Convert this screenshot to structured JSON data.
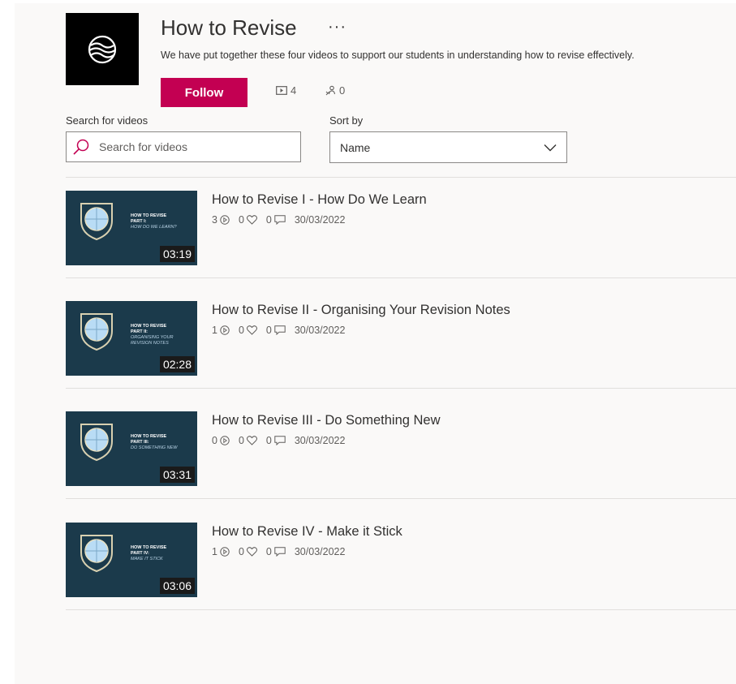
{
  "channel": {
    "title": "How to Revise",
    "more_label": "···",
    "description": "We have put together these four videos to support our students in understanding how to revise effectively.",
    "follow_label": "Follow",
    "video_count": "4",
    "follower_count": "0",
    "accent": "#c30052"
  },
  "search": {
    "label": "Search for videos",
    "placeholder": "Search for videos"
  },
  "sort": {
    "label": "Sort by",
    "selected": "Name"
  },
  "videos": [
    {
      "title": "How to Revise I - How Do We Learn",
      "views": "3",
      "likes": "0",
      "comments": "0",
      "date": "30/03/2022",
      "duration": "03:19",
      "thumb_title": "HOW TO REVISE",
      "thumb_part": "PART I:",
      "thumb_sub": "HOW DO WE LEARN?"
    },
    {
      "title": "How to Revise II - Organising Your Revision Notes",
      "views": "1",
      "likes": "0",
      "comments": "0",
      "date": "30/03/2022",
      "duration": "02:28",
      "thumb_title": "HOW TO REVISE",
      "thumb_part": "PART II:",
      "thumb_sub": "ORGANISING YOUR REVISION NOTES"
    },
    {
      "title": "How to Revise III - Do Something New",
      "views": "0",
      "likes": "0",
      "comments": "0",
      "date": "30/03/2022",
      "duration": "03:31",
      "thumb_title": "HOW TO REVISE",
      "thumb_part": "PART III:",
      "thumb_sub": "DO SOMETHING NEW"
    },
    {
      "title": "How to Revise IV - Make it Stick",
      "views": "1",
      "likes": "0",
      "comments": "0",
      "date": "30/03/2022",
      "duration": "03:06",
      "thumb_title": "HOW TO REVISE",
      "thumb_part": "PART IV:",
      "thumb_sub": "MAKE IT STICK"
    }
  ]
}
